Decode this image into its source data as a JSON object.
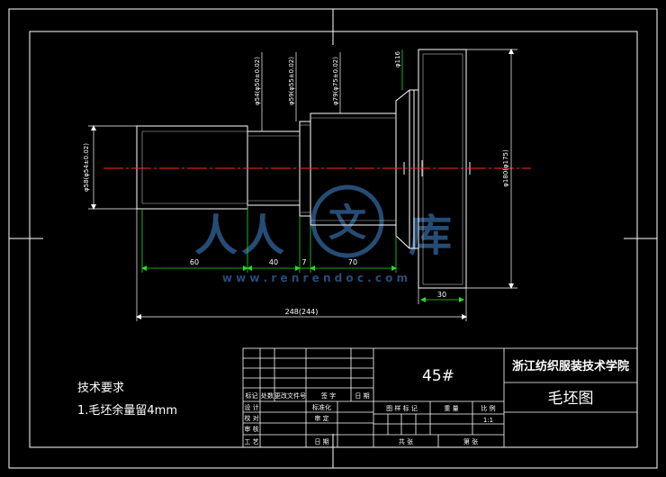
{
  "colors": {
    "background": "#000000",
    "outline": "#ffffff",
    "finish_outline": "#bdbdbd",
    "dimension": "#22dd22",
    "centerline": "#ff2a2a",
    "watermark": "#3f7fc4"
  },
  "dimensions": {
    "left_dia": "φ58(φ54±0.02)",
    "sec2_dia": "φ54(φ50±0.02)",
    "sec3_dia": "φ59(φ55±0.02)",
    "sec4_dia": "φ79(φ75±0.02)",
    "hub_dia": "φ116",
    "flange_dia": "φ180(φ175)",
    "len_sec1": "60",
    "len_sec2": "40",
    "len_sec3": "7",
    "len_sec4": "70",
    "len_flange": "30",
    "len_total": "248(244)"
  },
  "tech_requirements": {
    "title": "技术要求",
    "item1": "1.毛坯余量留4mm"
  },
  "title_block": {
    "school": "浙江纺织服装技术学院",
    "drawing_name": "毛坯图",
    "material": "45#",
    "rev_headers": [
      "标记",
      "处数",
      "更改文件号",
      "签 字",
      "日 期"
    ],
    "sign_labels": {
      "design": "设 计",
      "standardize": "标准化",
      "check": "校 对",
      "approve": "审 定",
      "review": "审 核",
      "process": "工 艺",
      "date": "日 期"
    },
    "info_headers": [
      "图 样 标 记",
      "重 量",
      "比 例"
    ],
    "scale": "1:1",
    "sheets_total": "共    张",
    "sheet_no": "第    张"
  },
  "watermark": {
    "chars": [
      "人",
      "人",
      "文",
      "库"
    ],
    "url": "w w w . r e n r e n d o c . c o m"
  }
}
